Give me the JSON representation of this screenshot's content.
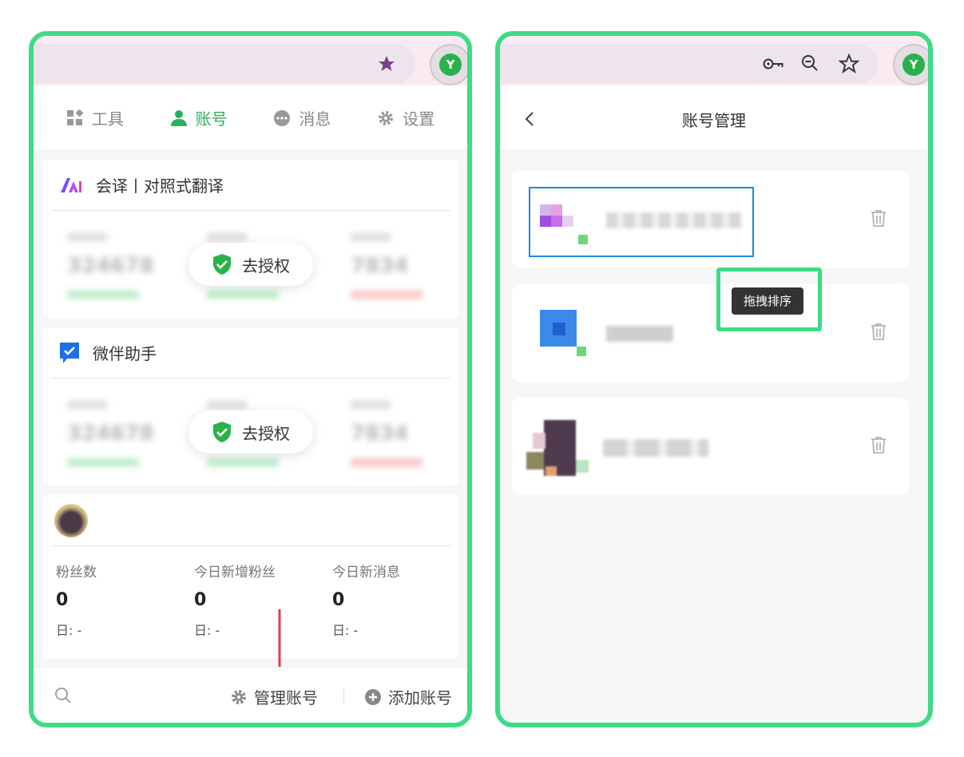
{
  "left": {
    "tabs": [
      {
        "label": "工具",
        "icon": "grid-icon"
      },
      {
        "label": "账号",
        "icon": "user-icon"
      },
      {
        "label": "消息",
        "icon": "message-icon"
      },
      {
        "label": "设置",
        "icon": "gear-icon"
      }
    ],
    "cards": [
      {
        "name": "会译丨对照式翻译",
        "auth_label": "去授权"
      },
      {
        "name": "微伴助手",
        "auth_label": "去授权"
      }
    ],
    "stats_card": {
      "columns": [
        {
          "label": "粉丝数",
          "value": "0",
          "day": "日: -"
        },
        {
          "label": "今日新增粉丝",
          "value": "0",
          "day": "日: -"
        },
        {
          "label": "今日新消息",
          "value": "0",
          "day": "日: -"
        }
      ]
    },
    "footer": {
      "manage_label": "管理账号",
      "add_label": "添加账号"
    }
  },
  "right": {
    "title": "账号管理",
    "tooltip": "拖拽排序"
  },
  "colors": {
    "accent": "#25b35c",
    "frame": "#3ddc84",
    "highlight": "#1e88e5",
    "arrow": "#e53950"
  }
}
